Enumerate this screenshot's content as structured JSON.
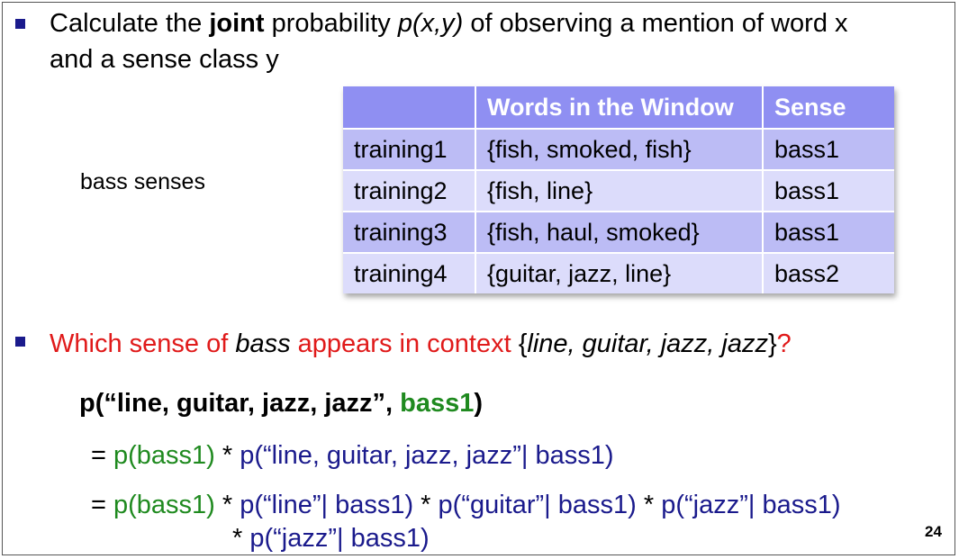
{
  "bullet1": {
    "line1_pre": "Calculate the ",
    "line1_bold": "joint",
    "line1_mid": " probability ",
    "line1_ital": "p(x,y)",
    "line1_post": " of observing a mention of word x",
    "line2": "and a sense class y"
  },
  "side_label": "bass senses",
  "table": {
    "headers": [
      "",
      "Words in the Window",
      "Sense"
    ],
    "rows": [
      [
        "training1",
        "{fish, smoked, fish}",
        "bass1"
      ],
      [
        "training2",
        "{fish, line}",
        "bass1"
      ],
      [
        "training3",
        "{fish, haul, smoked}",
        "bass1"
      ],
      [
        "training4",
        "{guitar, jazz, line}",
        "bass2"
      ]
    ]
  },
  "bullet2": {
    "pre": "Which sense of ",
    "ital_bass": "bass",
    "mid": " appears in context ",
    "brace_open": "{",
    "context": "line, guitar, jazz, jazz",
    "brace_close": "}",
    "q": "?"
  },
  "eq": {
    "line1_pre": "p(“line, guitar, jazz, jazz”, ",
    "line1_green": "bass1",
    "line1_post": ")",
    "line2_eq": "= ",
    "line2_green": "p(bass1)",
    "line2_star": " * ",
    "line2_blue": "p(“line, guitar, jazz, jazz”| bass1)",
    "line3_eq": "= ",
    "line3_green": "p(bass1)",
    "line3_star": " * ",
    "line3_blue_a": "p(“line”| bass1)",
    "line3_star2": " * ",
    "line3_blue_b": "p(“guitar”| bass1)",
    "line3_star3": " * ",
    "line3_blue_c": "p(“jazz”| bass1)",
    "line4_star": "* ",
    "line4_blue": "p(“jazz”| bass1)"
  },
  "page_number": "24",
  "colors": {
    "bullet": "#1a1a8c",
    "red": "#e01a1a",
    "green": "#1f8a1f",
    "navy": "#1a1a8c",
    "table_header": "#8f8ff2"
  }
}
